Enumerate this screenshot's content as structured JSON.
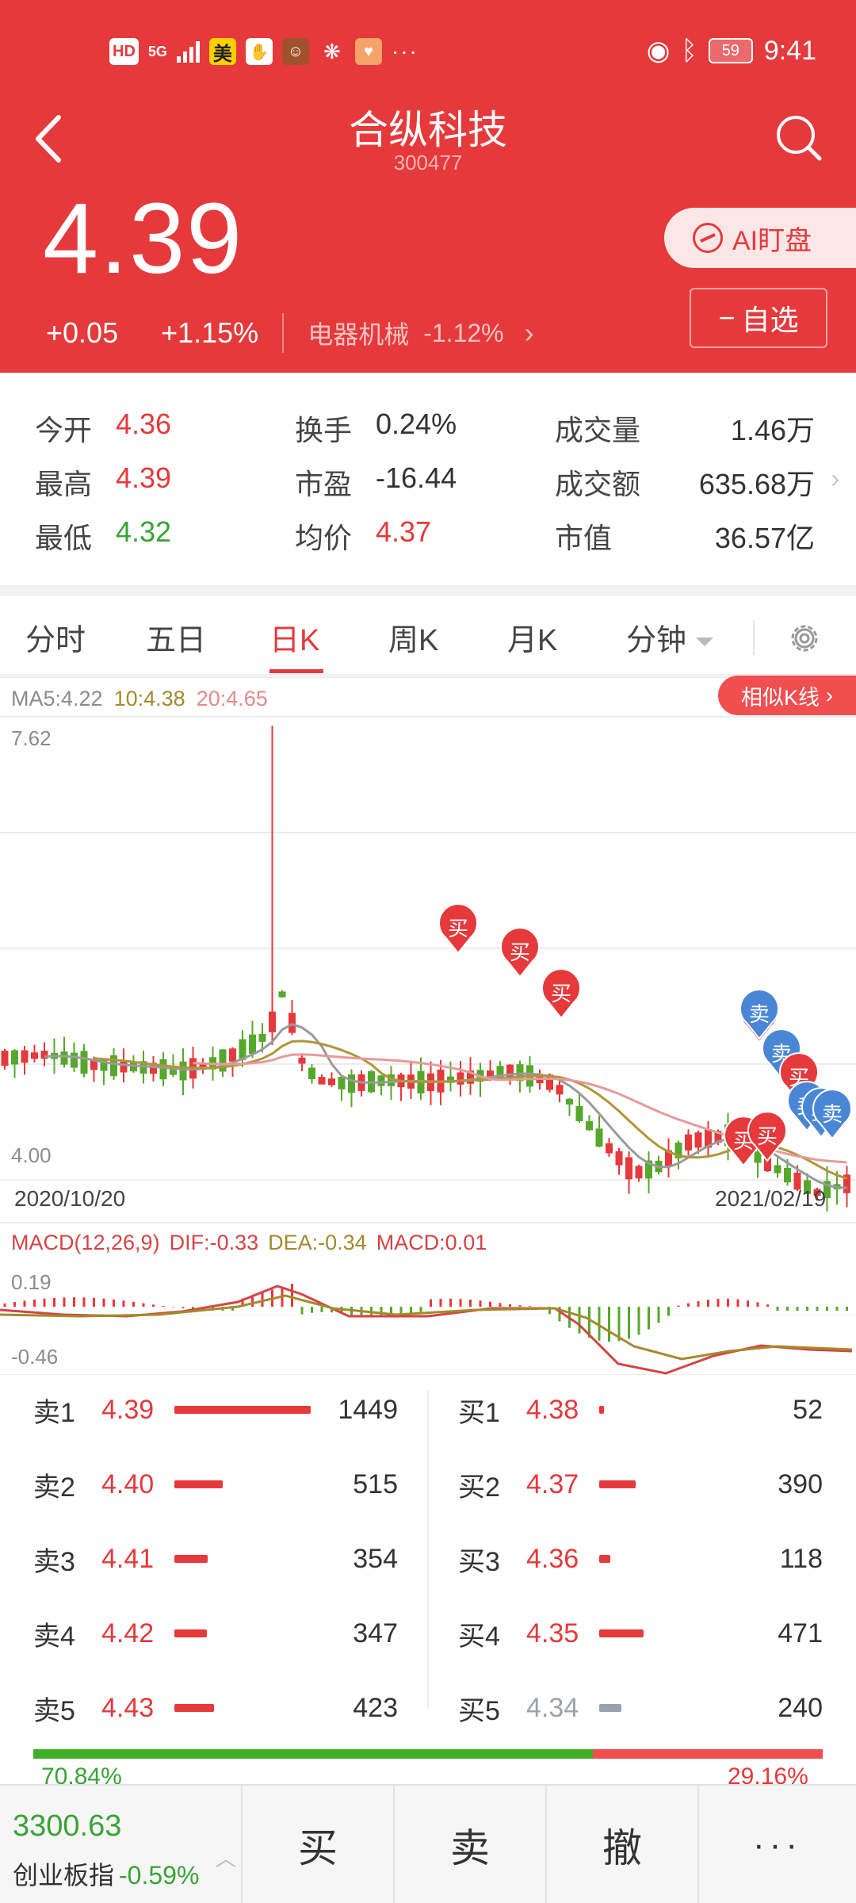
{
  "status_bar": {
    "left_icons": [
      "HD",
      "5G",
      "美"
    ],
    "more": "···",
    "battery": "59",
    "time": "9:41"
  },
  "header": {
    "title": "合纵科技",
    "code": "300477",
    "price": "4.39",
    "change": "+0.05",
    "change_pct": "+1.15%",
    "sector_name": "电器机械",
    "sector_pct": "-1.12%",
    "ai_button": "AI盯盘",
    "watch_button": "自选"
  },
  "stats": [
    {
      "label": "今开",
      "value": "4.36",
      "color": "red"
    },
    {
      "label": "换手",
      "value": "0.24%",
      "color": "dark"
    },
    {
      "label": "成交量",
      "value": "1.46万",
      "color": "dark"
    },
    {
      "label": "最高",
      "value": "4.39",
      "color": "red"
    },
    {
      "label": "市盈",
      "value": "-16.44",
      "color": "dark"
    },
    {
      "label": "成交额",
      "value": "635.68万",
      "color": "dark"
    },
    {
      "label": "最低",
      "value": "4.32",
      "color": "green"
    },
    {
      "label": "均价",
      "value": "4.37",
      "color": "red"
    },
    {
      "label": "市值",
      "value": "36.57亿",
      "color": "dark"
    }
  ],
  "tabs": [
    "分时",
    "五日",
    "日K",
    "周K",
    "月K",
    "分钟"
  ],
  "active_tab": "日K",
  "chart": {
    "ma5_label": "MA5:4.22",
    "ma10_label": "10:4.38",
    "ma20_label": "20:4.65",
    "similar_button": "相似K线",
    "y_top": "7.62",
    "y_bottom": "4.00",
    "date_start": "2020/10/20",
    "date_end": "2021/02/19",
    "macd_title": "MACD(12,26,9)",
    "dif_label": "DIF:-0.33",
    "dea_label": "DEA:-0.34",
    "macd_label": "MACD:0.01",
    "macd_top": "0.19",
    "macd_bottom": "-0.46",
    "buy_marker": "买",
    "sell_marker": "卖"
  },
  "chart_data": {
    "type": "candlestick",
    "x_range": [
      "2020/10/20",
      "2021/02/19"
    ],
    "y_range": [
      4.0,
      7.62
    ],
    "ma": {
      "MA5": 4.22,
      "MA10": 4.38,
      "MA20": 4.65
    },
    "macd": {
      "DIF": -0.33,
      "DEA": -0.34,
      "MACD": 0.01,
      "range": [
        -0.46,
        0.19
      ]
    }
  },
  "order_book": {
    "sell": [
      {
        "label": "卖1",
        "price": "4.39",
        "volume": "1449",
        "color": "#e5393b"
      },
      {
        "label": "卖2",
        "price": "4.40",
        "volume": "515",
        "color": "#e5393b"
      },
      {
        "label": "卖3",
        "price": "4.41",
        "volume": "354",
        "color": "#e5393b"
      },
      {
        "label": "卖4",
        "price": "4.42",
        "volume": "347",
        "color": "#e5393b"
      },
      {
        "label": "卖5",
        "price": "4.43",
        "volume": "423",
        "color": "#e5393b"
      }
    ],
    "buy": [
      {
        "label": "买1",
        "price": "4.38",
        "volume": "52",
        "color": "#e5393b"
      },
      {
        "label": "买2",
        "price": "4.37",
        "volume": "390",
        "color": "#e5393b"
      },
      {
        "label": "买3",
        "price": "4.36",
        "volume": "118",
        "color": "#e5393b"
      },
      {
        "label": "买4",
        "price": "4.35",
        "volume": "471",
        "color": "#e5393b"
      },
      {
        "label": "买5",
        "price": "4.34",
        "volume": "240",
        "color": "#9aa3ad"
      }
    ],
    "outer_pct": "70.84%",
    "inner_pct": "29.16%",
    "outer_fraction": 0.7084
  },
  "bottom": {
    "index_value": "3300.63",
    "index_name": "创业板指",
    "index_pct": "-0.59%",
    "buy": "买",
    "sell": "卖",
    "cancel": "撤",
    "more": "···"
  }
}
